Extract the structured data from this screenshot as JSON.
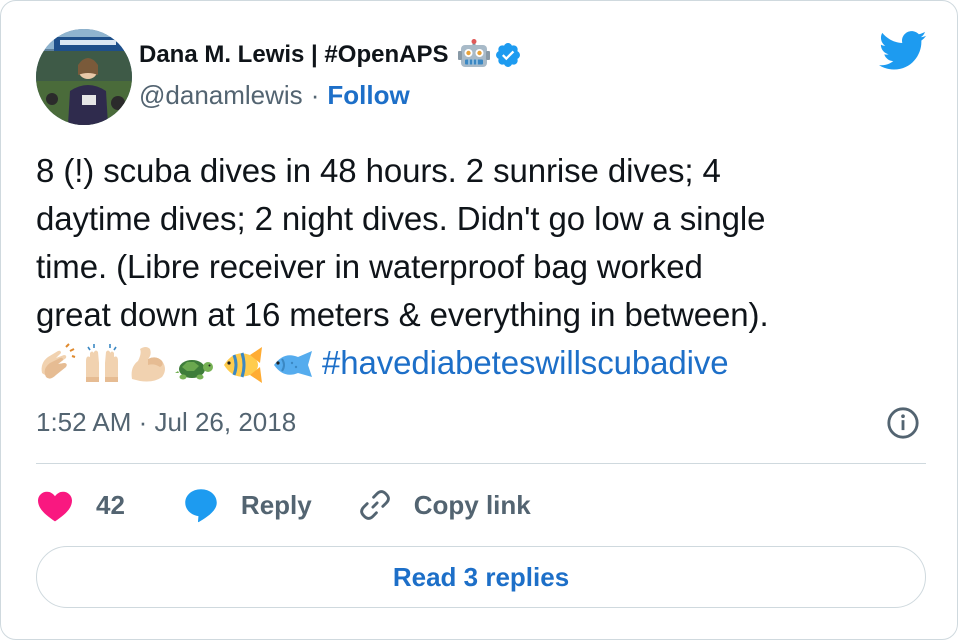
{
  "author": {
    "display_name": "Dana M. Lewis | #OpenAPS",
    "name_emoji": "robot-face-icon",
    "verified": true,
    "handle": "@danamlewis",
    "separator": "·",
    "follow_label": "Follow"
  },
  "tweet": {
    "lines": [
      "8 (!) scuba dives in 48 hours. 2 sunrise dives; 4",
      "daytime dives; 2 night dives. Didn't go low a single",
      "time. (Libre receiver in waterproof bag worked",
      "great down at 16 meters & everything in between)."
    ],
    "emojis": [
      "clapping-hands-icon",
      "raising-hands-icon",
      "flexed-biceps-icon",
      "turtle-icon",
      "tropical-fish-icon",
      "fish-icon"
    ],
    "hashtag": "#havediabeteswillscubadive",
    "timestamp": "1:52 AM · Jul 26, 2018"
  },
  "actions": {
    "like_count": "42",
    "reply_label": "Reply",
    "copy_link_label": "Copy link"
  },
  "read_replies_label": "Read 3 replies",
  "colors": {
    "text": "#0f1419",
    "secondary": "#536471",
    "link": "#1d6fc8",
    "twitter_blue": "#1d9bf0",
    "like": "#f91880",
    "border": "#cfd9de"
  }
}
